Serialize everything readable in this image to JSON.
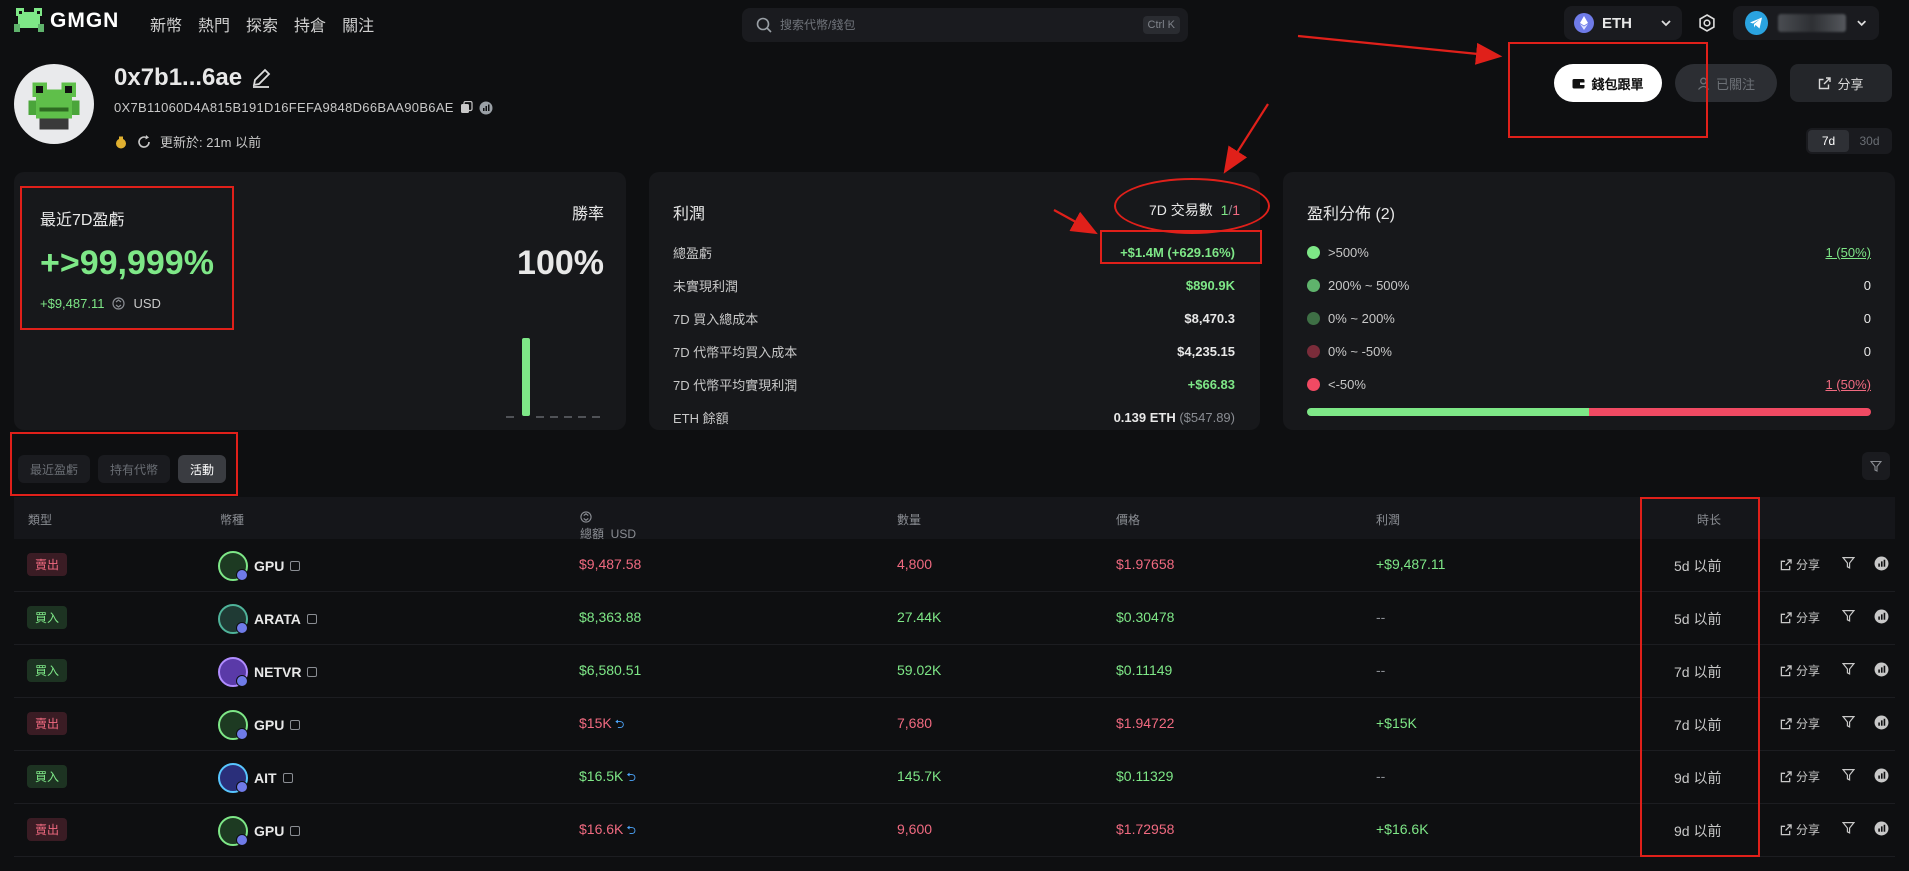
{
  "nav": {
    "logo": "GMGN",
    "items": [
      "新幣",
      "熱門",
      "探索",
      "持倉",
      "關注"
    ],
    "search_placeholder": "搜索代幣/錢包",
    "search_shortcut": "Ctrl K",
    "chain": "ETH"
  },
  "profile": {
    "name": "0x7b1...6ae",
    "address": "0X7B11060D4A815B191D16FEFA9848D66BAA90B6AE",
    "updated": "更新於: 21m 以前"
  },
  "actions": {
    "follow_wallet": "錢包跟單",
    "followed": "已關注",
    "share": "分享"
  },
  "periods": [
    "7d",
    "30d"
  ],
  "pnl_card": {
    "title": "最近7D盈虧",
    "value": "+>99,999%",
    "sub_value": "+$9,487.11",
    "sub_unit": "USD",
    "winrate_label": "勝率",
    "winrate_value": "100%"
  },
  "profit_card": {
    "title": "利潤",
    "tx_label": "7D 交易數",
    "tx_win": "1",
    "tx_sep": "/",
    "tx_loss": "1",
    "rows": [
      {
        "label": "總盈虧",
        "value": "+$1.4M (+629.16%)"
      },
      {
        "label": "未實現利潤",
        "value": "$890.9K"
      },
      {
        "label": "7D 買入總成本",
        "value": "$8,470.3"
      },
      {
        "label": "7D 代幣平均買入成本",
        "value": "$4,235.15"
      },
      {
        "label": "7D 代幣平均實現利潤",
        "value": "+$66.83"
      },
      {
        "label": "ETH 餘額",
        "value": "0.139 ETH",
        "value_extra": "($547.89)"
      }
    ]
  },
  "dist_card": {
    "title": "盈利分佈 (2)",
    "rows": [
      {
        "label": ">500%",
        "value": "1 (50%)",
        "color": "#7ee787"
      },
      {
        "label": "200% ~ 500%",
        "value": "0",
        "color": "#5fb36c"
      },
      {
        "label": "0% ~ 200%",
        "value": "0",
        "color": "#3e6f45"
      },
      {
        "label": "0% ~ -50%",
        "value": "0",
        "color": "#7a2c3a"
      },
      {
        "label": "<-50%",
        "value": "1 (50%)",
        "color": "#f04a63"
      }
    ],
    "bar_green_fraction": 0.5
  },
  "tabs": [
    "最近盈虧",
    "持有代幣",
    "活動"
  ],
  "table": {
    "headers": [
      "類型",
      "幣種",
      "總額  USD",
      "數量",
      "價格",
      "利潤",
      "時长"
    ],
    "share_label": "分享",
    "rows": [
      {
        "type": "賣出",
        "side": "sell",
        "token": "GPU",
        "total": "$9,487.58",
        "qty": "4,800",
        "price": "$1.97658",
        "profit": "+$9,487.11",
        "time": "5d 以前"
      },
      {
        "type": "買入",
        "side": "buy",
        "token": "ARATA",
        "total": "$8,363.88",
        "qty": "27.44K",
        "price": "$0.30478",
        "profit": "--",
        "time": "5d 以前"
      },
      {
        "type": "買入",
        "side": "buy",
        "token": "NETVR",
        "total": "$6,580.51",
        "qty": "59.02K",
        "price": "$0.11149",
        "profit": "--",
        "time": "7d 以前"
      },
      {
        "type": "賣出",
        "side": "sell",
        "token": "GPU",
        "total": "$15K",
        "qty": "7,680",
        "price": "$1.94722",
        "profit": "+$15K",
        "time": "7d 以前"
      },
      {
        "type": "買入",
        "side": "buy",
        "token": "AIT",
        "total": "$16.5K",
        "qty": "145.7K",
        "price": "$0.11329",
        "profit": "--",
        "time": "9d 以前"
      },
      {
        "type": "賣出",
        "side": "sell",
        "token": "GPU",
        "total": "$16.6K",
        "qty": "9,600",
        "price": "$1.72958",
        "profit": "+$16.6K",
        "time": "9d 以前"
      }
    ]
  }
}
